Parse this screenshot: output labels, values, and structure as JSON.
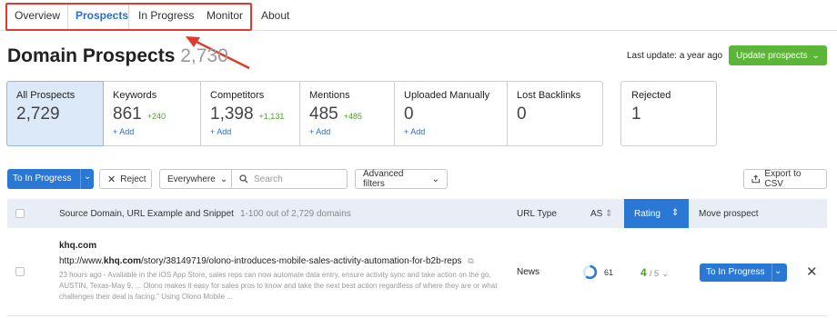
{
  "tabs": [
    {
      "label": "Overview"
    },
    {
      "label": "Prospects"
    },
    {
      "label": "In Progress"
    },
    {
      "label": "Monitor"
    },
    {
      "label": "About"
    }
  ],
  "active_tab": "Prospects",
  "page": {
    "title": "Domain Prospects",
    "count": "2,730"
  },
  "header": {
    "last_update": "Last update: a year ago",
    "update_button": "Update prospects"
  },
  "stats": [
    {
      "label": "All Prospects",
      "value": "2,729",
      "delta": "",
      "add": ""
    },
    {
      "label": "Keywords",
      "value": "861",
      "delta": "+240",
      "add": "+ Add"
    },
    {
      "label": "Competitors",
      "value": "1,398",
      "delta": "+1,131",
      "add": "+ Add"
    },
    {
      "label": "Mentions",
      "value": "485",
      "delta": "+485",
      "add": "+ Add"
    },
    {
      "label": "Uploaded Manually",
      "value": "0",
      "delta": "",
      "add": "+ Add"
    },
    {
      "label": "Lost Backlinks",
      "value": "0",
      "delta": "",
      "add": ""
    }
  ],
  "rejected": {
    "label": "Rejected",
    "value": "1"
  },
  "toolbar": {
    "to_in_progress": "To In Progress",
    "reject": "Reject",
    "location_select": "Everywhere",
    "search_placeholder": "Search",
    "advanced_filters": "Advanced filters",
    "export": "Export to CSV"
  },
  "table": {
    "headers": {
      "source": "Source Domain, URL Example and Snippet",
      "range": "1-100 out of 2,729 domains",
      "url_type": "URL Type",
      "as": "AS",
      "rating": "Rating",
      "move": "Move prospect"
    },
    "rows": [
      {
        "domain": "khq.com",
        "url_prefix": "http://www.",
        "url_bold": "khq.com",
        "url_rest": "/story/38149719/olono-introduces-mobile-sales-activity-automation-for-b2b-reps",
        "snippet": "23 hours ago - Available in the iOS App Store, sales reps can now automate data entry, ensure activity sync and take action on the go. AUSTIN, Texas-May 9, ... Olono makes it easy for sales pros to know and take the next best action regardless of where they are or what challenges their deal is facing.\" Using Olono Mobile ...",
        "url_type": "News",
        "as": "61",
        "as_fraction": 0.61,
        "rating": "4",
        "rating_max": "/ 5",
        "action": "To In Progress"
      }
    ]
  },
  "colors": {
    "accent": "#2a78d6",
    "green": "#5bb536",
    "highlight": "#e03a2f"
  }
}
